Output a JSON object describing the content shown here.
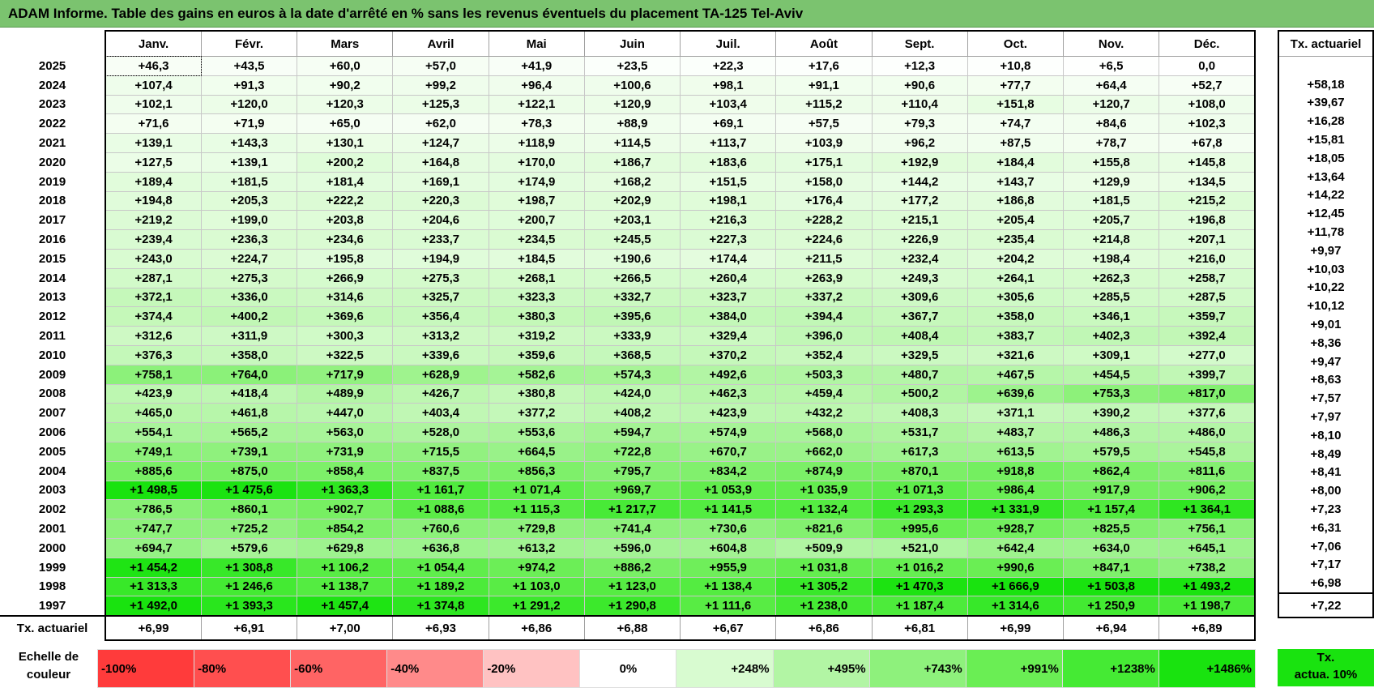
{
  "title": "ADAM Informe. Table des gains en euros à la date d'arrêté en % sans les revenus éventuels du placement TA-125 Tel-Aviv",
  "months": [
    "Janv.",
    "Févr.",
    "Mars",
    "Avril",
    "Mai",
    "Juin",
    "Juil.",
    "Août",
    "Sept.",
    "Oct.",
    "Nov.",
    "Déc."
  ],
  "rate_header": "Tx. actuariel",
  "rows": [
    {
      "year": "2025",
      "values": [
        "+46,3",
        "+43,5",
        "+60,0",
        "+57,0",
        "+41,9",
        "+23,5",
        "+22,3",
        "+17,6",
        "+12,3",
        "+10,8",
        "+6,5",
        "0,0"
      ],
      "rate": ""
    },
    {
      "year": "2024",
      "values": [
        "+107,4",
        "+91,3",
        "+90,2",
        "+99,2",
        "+96,4",
        "+100,6",
        "+98,1",
        "+91,1",
        "+90,6",
        "+77,7",
        "+64,4",
        "+52,7"
      ],
      "rate": "+58,18"
    },
    {
      "year": "2023",
      "values": [
        "+102,1",
        "+120,0",
        "+120,3",
        "+125,3",
        "+122,1",
        "+120,9",
        "+103,4",
        "+115,2",
        "+110,4",
        "+151,8",
        "+120,7",
        "+108,0"
      ],
      "rate": "+39,67"
    },
    {
      "year": "2022",
      "values": [
        "+71,6",
        "+71,9",
        "+65,0",
        "+62,0",
        "+78,3",
        "+88,9",
        "+69,1",
        "+57,5",
        "+79,3",
        "+74,7",
        "+84,6",
        "+102,3"
      ],
      "rate": "+16,28"
    },
    {
      "year": "2021",
      "values": [
        "+139,1",
        "+143,3",
        "+130,1",
        "+124,7",
        "+118,9",
        "+114,5",
        "+113,7",
        "+103,9",
        "+96,2",
        "+87,5",
        "+78,7",
        "+67,8"
      ],
      "rate": "+15,81"
    },
    {
      "year": "2020",
      "values": [
        "+127,5",
        "+139,1",
        "+200,2",
        "+164,8",
        "+170,0",
        "+186,7",
        "+183,6",
        "+175,1",
        "+192,9",
        "+184,4",
        "+155,8",
        "+145,8"
      ],
      "rate": "+18,05"
    },
    {
      "year": "2019",
      "values": [
        "+189,4",
        "+181,5",
        "+181,4",
        "+169,1",
        "+174,9",
        "+168,2",
        "+151,5",
        "+158,0",
        "+144,2",
        "+143,7",
        "+129,9",
        "+134,5"
      ],
      "rate": "+13,64"
    },
    {
      "year": "2018",
      "values": [
        "+194,8",
        "+205,3",
        "+222,2",
        "+220,3",
        "+198,7",
        "+202,9",
        "+198,1",
        "+176,4",
        "+177,2",
        "+186,8",
        "+181,5",
        "+215,2"
      ],
      "rate": "+14,22"
    },
    {
      "year": "2017",
      "values": [
        "+219,2",
        "+199,0",
        "+203,8",
        "+204,6",
        "+200,7",
        "+203,1",
        "+216,3",
        "+228,2",
        "+215,1",
        "+205,4",
        "+205,7",
        "+196,8"
      ],
      "rate": "+12,45"
    },
    {
      "year": "2016",
      "values": [
        "+239,4",
        "+236,3",
        "+234,6",
        "+233,7",
        "+234,5",
        "+245,5",
        "+227,3",
        "+224,6",
        "+226,9",
        "+235,4",
        "+214,8",
        "+207,1"
      ],
      "rate": "+11,78"
    },
    {
      "year": "2015",
      "values": [
        "+243,0",
        "+224,7",
        "+195,8",
        "+194,9",
        "+184,5",
        "+190,6",
        "+174,4",
        "+211,5",
        "+232,4",
        "+204,2",
        "+198,4",
        "+216,0"
      ],
      "rate": "+9,97"
    },
    {
      "year": "2014",
      "values": [
        "+287,1",
        "+275,3",
        "+266,9",
        "+275,3",
        "+268,1",
        "+266,5",
        "+260,4",
        "+263,9",
        "+249,3",
        "+264,1",
        "+262,3",
        "+258,7"
      ],
      "rate": "+10,03"
    },
    {
      "year": "2013",
      "values": [
        "+372,1",
        "+336,0",
        "+314,6",
        "+325,7",
        "+323,3",
        "+332,7",
        "+323,7",
        "+337,2",
        "+309,6",
        "+305,6",
        "+285,5",
        "+287,5"
      ],
      "rate": "+10,22"
    },
    {
      "year": "2012",
      "values": [
        "+374,4",
        "+400,2",
        "+369,6",
        "+356,4",
        "+380,3",
        "+395,6",
        "+384,0",
        "+394,4",
        "+367,7",
        "+358,0",
        "+346,1",
        "+359,7"
      ],
      "rate": "+10,12"
    },
    {
      "year": "2011",
      "values": [
        "+312,6",
        "+311,9",
        "+300,3",
        "+313,2",
        "+319,2",
        "+333,9",
        "+329,4",
        "+396,0",
        "+408,4",
        "+383,7",
        "+402,3",
        "+392,4"
      ],
      "rate": "+9,01"
    },
    {
      "year": "2010",
      "values": [
        "+376,3",
        "+358,0",
        "+322,5",
        "+339,6",
        "+359,6",
        "+368,5",
        "+370,2",
        "+352,4",
        "+329,5",
        "+321,6",
        "+309,1",
        "+277,0"
      ],
      "rate": "+8,36"
    },
    {
      "year": "2009",
      "values": [
        "+758,1",
        "+764,0",
        "+717,9",
        "+628,9",
        "+582,6",
        "+574,3",
        "+492,6",
        "+503,3",
        "+480,7",
        "+467,5",
        "+454,5",
        "+399,7"
      ],
      "rate": "+9,47"
    },
    {
      "year": "2008",
      "values": [
        "+423,9",
        "+418,4",
        "+489,9",
        "+426,7",
        "+380,8",
        "+424,0",
        "+462,3",
        "+459,4",
        "+500,2",
        "+639,6",
        "+753,3",
        "+817,0"
      ],
      "rate": "+8,63"
    },
    {
      "year": "2007",
      "values": [
        "+465,0",
        "+461,8",
        "+447,0",
        "+403,4",
        "+377,2",
        "+408,2",
        "+423,9",
        "+432,2",
        "+408,3",
        "+371,1",
        "+390,2",
        "+377,6"
      ],
      "rate": "+7,57"
    },
    {
      "year": "2006",
      "values": [
        "+554,1",
        "+565,2",
        "+563,0",
        "+528,0",
        "+553,6",
        "+594,7",
        "+574,9",
        "+568,0",
        "+531,7",
        "+483,7",
        "+486,3",
        "+486,0"
      ],
      "rate": "+7,97"
    },
    {
      "year": "2005",
      "values": [
        "+749,1",
        "+739,1",
        "+731,9",
        "+715,5",
        "+664,5",
        "+722,8",
        "+670,7",
        "+662,0",
        "+617,3",
        "+613,5",
        "+579,5",
        "+545,8"
      ],
      "rate": "+8,10"
    },
    {
      "year": "2004",
      "values": [
        "+885,6",
        "+875,0",
        "+858,4",
        "+837,5",
        "+856,3",
        "+795,7",
        "+834,2",
        "+874,9",
        "+870,1",
        "+918,8",
        "+862,4",
        "+811,6"
      ],
      "rate": "+8,49"
    },
    {
      "year": "2003",
      "values": [
        "+1 498,5",
        "+1 475,6",
        "+1 363,3",
        "+1 161,7",
        "+1 071,4",
        "+969,7",
        "+1 053,9",
        "+1 035,9",
        "+1 071,3",
        "+986,4",
        "+917,9",
        "+906,2"
      ],
      "rate": "+8,41"
    },
    {
      "year": "2002",
      "values": [
        "+786,5",
        "+860,1",
        "+902,7",
        "+1 088,6",
        "+1 115,3",
        "+1 217,7",
        "+1 141,5",
        "+1 132,4",
        "+1 293,3",
        "+1 331,9",
        "+1 157,4",
        "+1 364,1"
      ],
      "rate": "+8,00"
    },
    {
      "year": "2001",
      "values": [
        "+747,7",
        "+725,2",
        "+854,2",
        "+760,6",
        "+729,8",
        "+741,4",
        "+730,6",
        "+821,6",
        "+995,6",
        "+928,7",
        "+825,5",
        "+756,1"
      ],
      "rate": "+7,23"
    },
    {
      "year": "2000",
      "values": [
        "+694,7",
        "+579,6",
        "+629,8",
        "+636,8",
        "+613,2",
        "+596,0",
        "+604,8",
        "+509,9",
        "+521,0",
        "+642,4",
        "+634,0",
        "+645,1"
      ],
      "rate": "+6,31"
    },
    {
      "year": "1999",
      "values": [
        "+1 454,2",
        "+1 308,8",
        "+1 106,2",
        "+1 054,4",
        "+974,2",
        "+886,2",
        "+955,9",
        "+1 031,8",
        "+1 016,2",
        "+990,6",
        "+847,1",
        "+738,2"
      ],
      "rate": "+7,06"
    },
    {
      "year": "1998",
      "values": [
        "+1 313,3",
        "+1 246,6",
        "+1 138,7",
        "+1 189,2",
        "+1 103,0",
        "+1 123,0",
        "+1 138,4",
        "+1 305,2",
        "+1 470,3",
        "+1 666,9",
        "+1 503,8",
        "+1 493,2"
      ],
      "rate": "+7,17"
    },
    {
      "year": "1997",
      "values": [
        "+1 492,0",
        "+1 393,3",
        "+1 457,4",
        "+1 374,8",
        "+1 291,2",
        "+1 290,8",
        "+1 111,6",
        "+1 238,0",
        "+1 187,4",
        "+1 314,6",
        "+1 250,9",
        "+1 198,7"
      ],
      "rate": "+6,98"
    }
  ],
  "footer": {
    "label": "Tx. actuariel",
    "values": [
      "+6,99",
      "+6,91",
      "+7,00",
      "+6,93",
      "+6,86",
      "+6,88",
      "+6,67",
      "+6,86",
      "+6,81",
      "+6,99",
      "+6,94",
      "+6,89"
    ],
    "rate": "+7,22"
  },
  "scale": {
    "label_line1": "Echelle de",
    "label_line2": "couleur",
    "steps": [
      {
        "label": "-100%",
        "color": "#ff3b3b"
      },
      {
        "label": "-80%",
        "color": "#ff4f4f"
      },
      {
        "label": "-60%",
        "color": "#ff6464"
      },
      {
        "label": "-40%",
        "color": "#ff8a8a"
      },
      {
        "label": "-20%",
        "color": "#ffc2c2"
      },
      {
        "label": "0%",
        "color": "#ffffff"
      },
      {
        "label": "+248%",
        "color": "#d8fbd0"
      },
      {
        "label": "+495%",
        "color": "#b2f5a4"
      },
      {
        "label": "+743%",
        "color": "#8ef17c"
      },
      {
        "label": "+991%",
        "color": "#6aee54"
      },
      {
        "label": "+1238%",
        "color": "#45ea34"
      },
      {
        "label": "+1486%",
        "color": "#19e30f"
      }
    ],
    "rate_line1": "Tx.",
    "rate_line2": "actua. 10%",
    "rate_color": "#19e30f"
  }
}
